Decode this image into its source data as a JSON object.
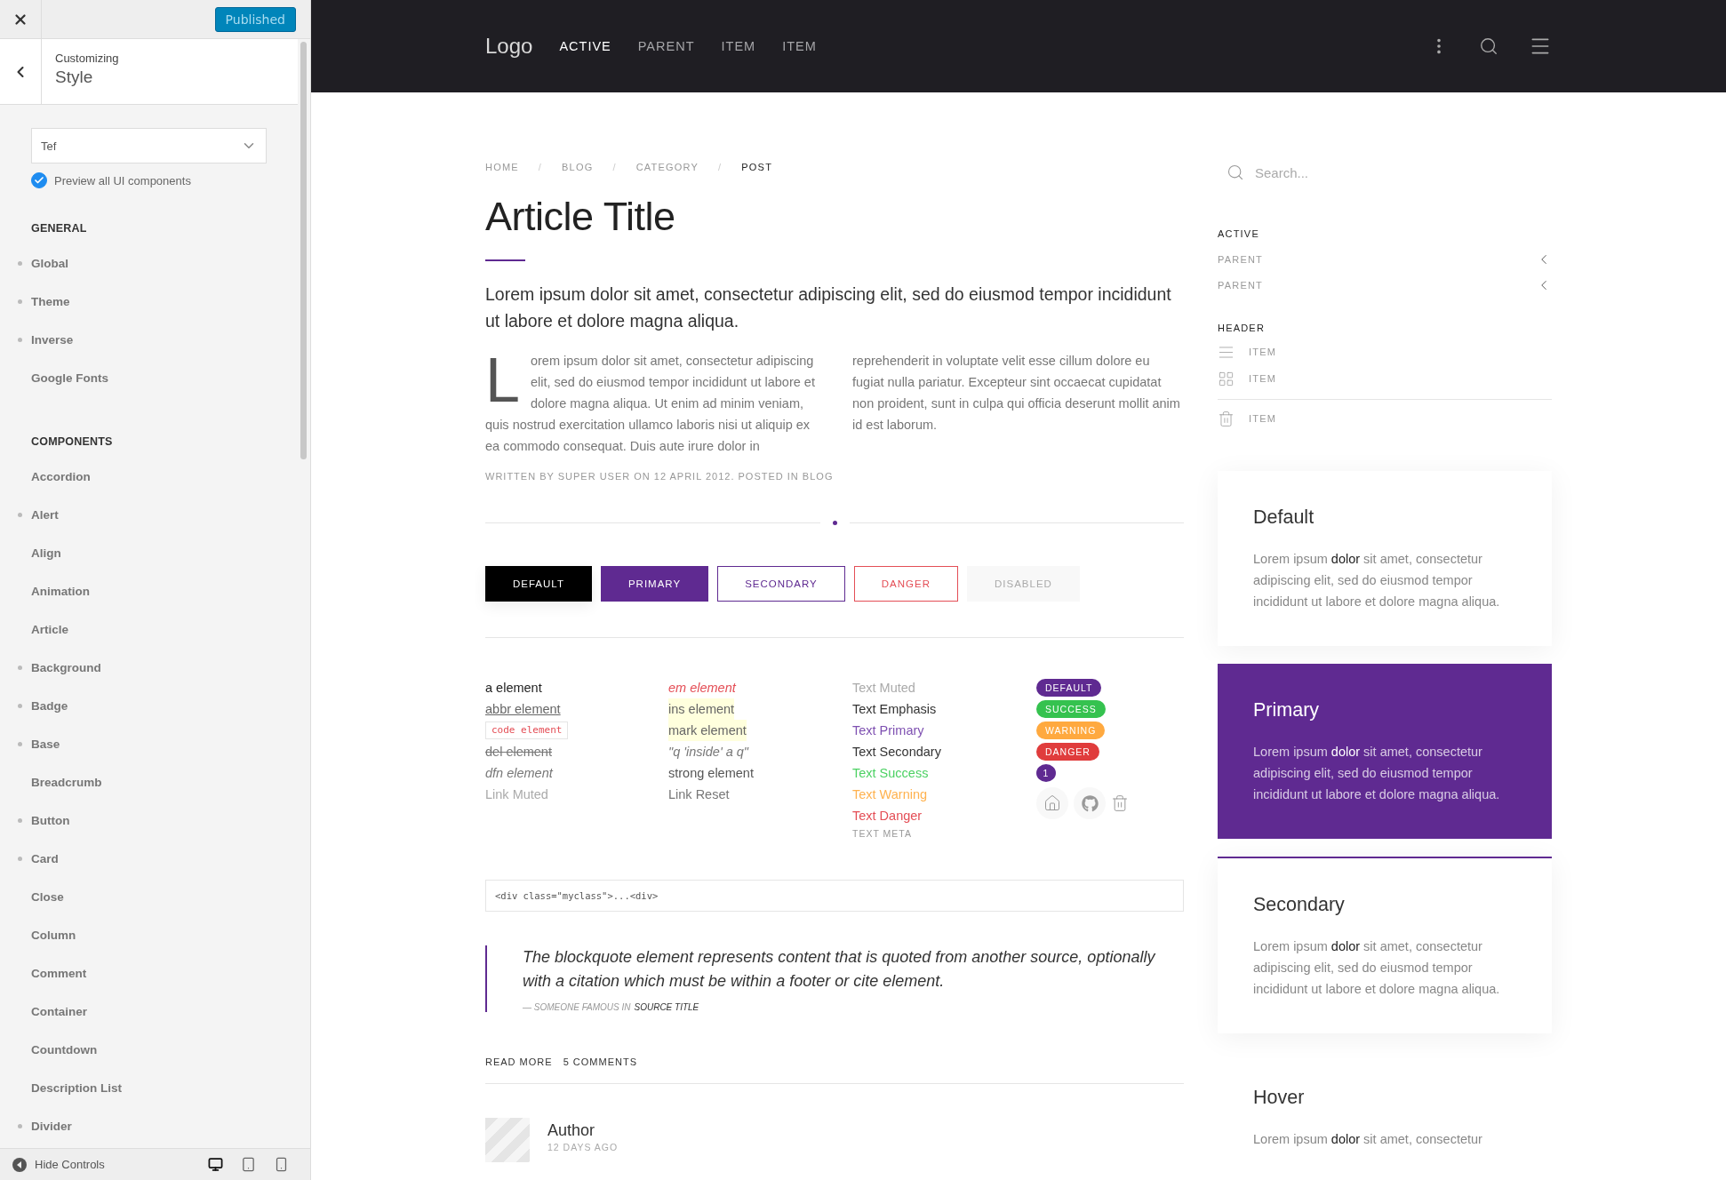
{
  "customizer": {
    "publish_button": "Published",
    "caption": "Customizing",
    "title": "Style",
    "select": {
      "value": "Tef"
    },
    "preview_checkbox": {
      "label": "Preview all UI components",
      "checked": true
    },
    "sections": [
      {
        "heading": "GENERAL",
        "items": [
          {
            "label": "Global",
            "modified": true
          },
          {
            "label": "Theme",
            "modified": true
          },
          {
            "label": "Inverse",
            "modified": true
          },
          {
            "label": "Google Fonts",
            "modified": false
          }
        ]
      },
      {
        "heading": "COMPONENTS",
        "items": [
          {
            "label": "Accordion",
            "modified": false
          },
          {
            "label": "Alert",
            "modified": true
          },
          {
            "label": "Align",
            "modified": false
          },
          {
            "label": "Animation",
            "modified": false
          },
          {
            "label": "Article",
            "modified": false
          },
          {
            "label": "Background",
            "modified": true
          },
          {
            "label": "Badge",
            "modified": true
          },
          {
            "label": "Base",
            "modified": true
          },
          {
            "label": "Breadcrumb",
            "modified": false
          },
          {
            "label": "Button",
            "modified": true
          },
          {
            "label": "Card",
            "modified": true
          },
          {
            "label": "Close",
            "modified": false
          },
          {
            "label": "Column",
            "modified": false
          },
          {
            "label": "Comment",
            "modified": false
          },
          {
            "label": "Container",
            "modified": false
          },
          {
            "label": "Countdown",
            "modified": false
          },
          {
            "label": "Description List",
            "modified": false
          },
          {
            "label": "Divider",
            "modified": true
          }
        ]
      }
    ],
    "footer": {
      "label": "Hide Controls",
      "devices": [
        {
          "kind": "desktop",
          "selected": true
        },
        {
          "kind": "tablet",
          "selected": false
        },
        {
          "kind": "mobile",
          "selected": false
        }
      ]
    }
  },
  "navbar": {
    "logo": "Logo",
    "items": [
      {
        "label": "ACTIVE",
        "selected": true
      },
      {
        "label": "PARENT",
        "selected": false
      },
      {
        "label": "ITEM",
        "selected": false
      },
      {
        "label": "ITEM",
        "selected": false
      }
    ]
  },
  "breadcrumb_separators": [
    "/",
    "/",
    "/"
  ],
  "breadcrumb": [
    {
      "label": "HOME",
      "selected": false
    },
    {
      "label": "BLOG",
      "selected": false
    },
    {
      "label": "CATEGORY",
      "selected": false
    },
    {
      "label": "POST",
      "selected": true
    }
  ],
  "article": {
    "title": "Article Title",
    "lead": "Lorem ipsum dolor sit amet, consectetur adipiscing elit, sed do eiusmod tempor incididunt ut labore et dolore magna aliqua.",
    "body": "Lorem ipsum dolor sit amet, consectetur adipiscing elit, sed do eiusmod tempor incididunt ut labore et dolore magna aliqua. Ut enim ad minim veniam, quis nostrud exercitation ullamco laboris nisi ut aliquip ex ea commodo consequat. Duis aute irure dolor in reprehenderit in voluptate velit esse cillum dolore eu fugiat nulla pariatur. Excepteur sint occaecat cupidatat non proident, sunt in culpa qui officia deserunt mollit anim id est laborum.",
    "meta": "WRITTEN BY SUPER USER ON 12 APRIL 2012. POSTED IN BLOG"
  },
  "buttons": [
    {
      "label": "DEFAULT",
      "kind": "default"
    },
    {
      "label": "PRIMARY",
      "kind": "primary"
    },
    {
      "label": "SECONDARY",
      "kind": "secondary"
    },
    {
      "label": "DANGER",
      "kind": "danger"
    },
    {
      "label": "DISABLED",
      "kind": "disabled"
    }
  ],
  "typography": [
    [
      {
        "text": "a element",
        "kind": "link"
      },
      {
        "text": "abbr element",
        "kind": "abbr"
      },
      {
        "text": "code element",
        "kind": "code"
      },
      {
        "text": "del element",
        "kind": "del"
      },
      {
        "text": "dfn element",
        "kind": "dfn"
      },
      {
        "text": "Link Muted",
        "kind": "link_muted"
      }
    ],
    [
      {
        "text": "em element",
        "kind": "em"
      },
      {
        "text": "ins element",
        "kind": "ins"
      },
      {
        "text": "mark element",
        "kind": "mark"
      },
      {
        "text": "\"q 'inside' a q\"",
        "kind": "q"
      },
      {
        "text": "strong element",
        "kind": "strong"
      },
      {
        "text": "Link Reset",
        "kind": "link_reset"
      }
    ],
    [
      {
        "text": "Text Muted",
        "kind": "muted"
      },
      {
        "text": "Text Emphasis",
        "kind": "emphasis"
      },
      {
        "text": "Text Primary",
        "kind": "primary"
      },
      {
        "text": "Text Secondary",
        "kind": "secondary"
      },
      {
        "text": "Text Success",
        "kind": "success"
      },
      {
        "text": "Text Warning",
        "kind": "warning"
      },
      {
        "text": "Text Danger",
        "kind": "danger"
      },
      {
        "text": "TEXT META",
        "kind": "meta"
      }
    ]
  ],
  "labels": [
    {
      "text": "DEFAULT",
      "kind": "default"
    },
    {
      "text": "SUCCESS",
      "kind": "success"
    },
    {
      "text": "WARNING",
      "kind": "warning"
    },
    {
      "text": "DANGER",
      "kind": "danger"
    },
    {
      "text": "1",
      "kind": "count"
    }
  ],
  "code_block": "<div class=\"myclass\">...<div>",
  "blockquote": {
    "text": "The blockquote element represents content that is quoted from another source, optionally with a citation which must be within a footer or cite element.",
    "cite": "— SOMEONE FAMOUS IN",
    "source": "SOURCE TITLE"
  },
  "links": [
    "READ MORE",
    "5 COMMENTS"
  ],
  "comment": {
    "author": "Author",
    "meta": "12 DAYS AGO"
  },
  "sidebar": {
    "search": {
      "placeholder": "Search..."
    },
    "nav": [
      {
        "label": "ACTIVE",
        "kind": "active"
      },
      {
        "label": "PARENT",
        "kind": "parent"
      },
      {
        "label": "PARENT",
        "kind": "parent"
      },
      {
        "label": "HEADER",
        "kind": "header"
      },
      {
        "label": "ITEM",
        "kind": "list"
      },
      {
        "label": "ITEM",
        "kind": "grid"
      },
      {
        "kind": "divider"
      },
      {
        "label": "ITEM",
        "kind": "trash"
      }
    ],
    "cards": [
      {
        "title": "Default",
        "text": "Lorem ipsum **dolor** sit amet, consectetur adipiscing elit, sed do eiusmod tempor incididunt ut labore et dolore magna aliqua.",
        "kind": "default"
      },
      {
        "title": "Primary",
        "text": "Lorem ipsum **dolor** sit amet, consectetur adipiscing elit, sed do eiusmod tempor incididunt ut labore et dolore magna aliqua.",
        "kind": "primary"
      },
      {
        "title": "Secondary",
        "text": "Lorem ipsum **dolor** sit amet, consectetur adipiscing elit, sed do eiusmod tempor incididunt ut labore et dolore magna aliqua.",
        "kind": "secondary"
      },
      {
        "title": "Hover",
        "text": "Lorem ipsum **dolor** sit amet, consectetur",
        "kind": "hover"
      }
    ]
  }
}
